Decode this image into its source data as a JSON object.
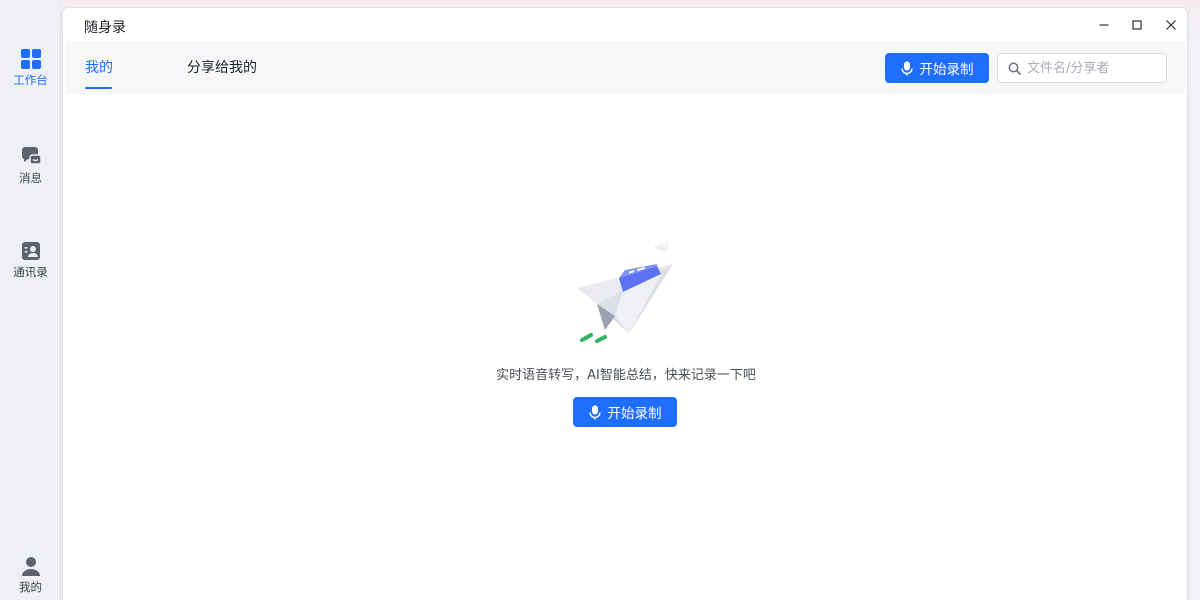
{
  "app": {
    "window_title": "随身录"
  },
  "nav": {
    "items": [
      {
        "label": "工作台",
        "icon": "grid-icon",
        "active": true
      },
      {
        "label": "消息",
        "icon": "chat-icon",
        "active": false
      },
      {
        "label": "通讯录",
        "icon": "contacts-icon",
        "active": false
      },
      {
        "label": "我的",
        "icon": "user-icon",
        "active": false
      }
    ]
  },
  "tabs": [
    {
      "label": "我的",
      "active": true
    },
    {
      "label": "分享给我的",
      "active": false
    }
  ],
  "toolbar": {
    "record_label": "开始录制",
    "search_placeholder": "文件名/分享者",
    "search_value": ""
  },
  "empty_state": {
    "message": "实时语音转写，AI智能总结，快来记录一下吧",
    "record_label": "开始录制"
  },
  "colors": {
    "accent": "#1f6fff",
    "nav_bg": "#eef0f5",
    "toolbar_bg": "#f6f7f9",
    "illustration_green": "#2fb35b"
  }
}
